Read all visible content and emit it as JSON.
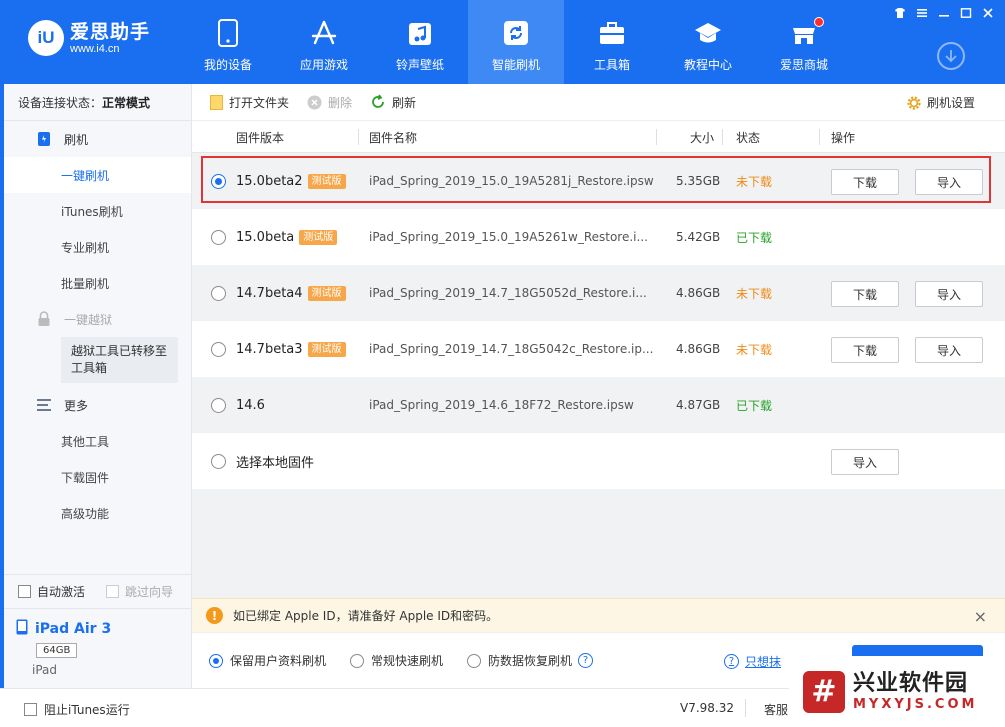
{
  "app": {
    "logo_mark": "iU",
    "name": "爱思助手",
    "url": "www.i4.cn"
  },
  "nav": [
    {
      "label": "我的设备",
      "icon": "phone-icon"
    },
    {
      "label": "应用游戏",
      "icon": "app-store-icon"
    },
    {
      "label": "铃声壁纸",
      "icon": "music-icon"
    },
    {
      "label": "智能刷机",
      "icon": "refresh-icon",
      "active": true
    },
    {
      "label": "工具箱",
      "icon": "toolbox-icon"
    },
    {
      "label": "教程中心",
      "icon": "graduation-cap-icon"
    },
    {
      "label": "爱思商城",
      "icon": "store-icon",
      "has_dot": true
    }
  ],
  "sidebar": {
    "status_label": "设备连接状态：",
    "status_value": "正常模式",
    "flash_section": "刷机",
    "items": [
      "一键刷机",
      "iTunes刷机",
      "专业刷机",
      "批量刷机"
    ],
    "jailbreak_section": "一键越狱",
    "jailbreak_note": "越狱工具已转移至工具箱",
    "more_section": "更多",
    "more_items": [
      "其他工具",
      "下载固件",
      "高级功能"
    ],
    "auto_activate": "自动激活",
    "skip_guide": "跳过向导",
    "device_name": "iPad Air 3",
    "device_capacity": "64GB",
    "device_type": "iPad"
  },
  "toolbar": {
    "open_folder": "打开文件夹",
    "delete": "删除",
    "refresh": "刷新",
    "settings": "刷机设置"
  },
  "table": {
    "headers": {
      "version": "固件版本",
      "name": "固件名称",
      "size": "大小",
      "status": "状态",
      "action": "操作"
    },
    "badge": "测试版",
    "download_label": "下载",
    "import_label": "导入",
    "rows": [
      {
        "version": "15.0beta2",
        "beta": true,
        "name": "iPad_Spring_2019_15.0_19A5281j_Restore.ipsw",
        "size": "5.35GB",
        "status": "未下载",
        "downloaded": false,
        "selected": true
      },
      {
        "version": "15.0beta",
        "beta": true,
        "name": "iPad_Spring_2019_15.0_19A5261w_Restore.i...",
        "size": "5.42GB",
        "status": "已下载",
        "downloaded": true
      },
      {
        "version": "14.7beta4",
        "beta": true,
        "name": "iPad_Spring_2019_14.7_18G5052d_Restore.i...",
        "size": "4.86GB",
        "status": "未下载",
        "downloaded": false
      },
      {
        "version": "14.7beta3",
        "beta": true,
        "name": "iPad_Spring_2019_14.7_18G5042c_Restore.ip...",
        "size": "4.86GB",
        "status": "未下载",
        "downloaded": false
      },
      {
        "version": "14.6",
        "beta": false,
        "name": "iPad_Spring_2019_14.6_18F72_Restore.ipsw",
        "size": "4.87GB",
        "status": "已下载",
        "downloaded": true
      }
    ],
    "local_row": "选择本地固件"
  },
  "notice": {
    "text": "如已绑定 Apple ID，请准备好 Apple ID和密码。"
  },
  "options": {
    "keep_data": "保留用户资料刷机",
    "quick": "常规快速刷机",
    "anti_loss": "防数据恢复刷机",
    "erase_link": "只想抹"
  },
  "statusbar": {
    "block_itunes": "阻止iTunes运行",
    "version": "V7.98.32",
    "service": "客服"
  },
  "watermark": {
    "mark": "#",
    "name": "兴业软件园",
    "domain": "MYXYJS.COM"
  },
  "colors": {
    "brand": "#1a6ff0",
    "not_downloaded": "#f08a14",
    "downloaded": "#2aa12a",
    "beta_badge": "#f7a74a",
    "highlight": "#e53333"
  }
}
